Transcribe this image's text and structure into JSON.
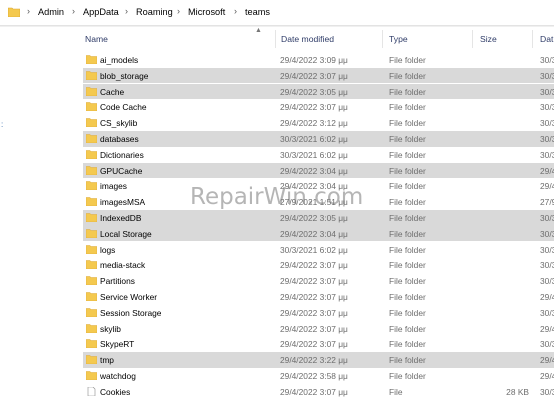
{
  "breadcrumb": [
    "Admin",
    "AppData",
    "Roaming",
    "Microsoft",
    "teams"
  ],
  "sidebar": {
    "glyph": ":"
  },
  "columns": {
    "name": "Name",
    "date": "Date modified",
    "type": "Type",
    "size": "Size",
    "date2": "Dat"
  },
  "rows": [
    {
      "name": "ai_models",
      "date": "29/4/2022 3:09 μμ",
      "type": "File folder",
      "size": "",
      "date2": "30/3",
      "selected": false,
      "kind": "folder"
    },
    {
      "name": "blob_storage",
      "date": "29/4/2022 3:07 μμ",
      "type": "File folder",
      "size": "",
      "date2": "30/3",
      "selected": true,
      "kind": "folder"
    },
    {
      "name": "Cache",
      "date": "29/4/2022 3:05 μμ",
      "type": "File folder",
      "size": "",
      "date2": "30/3",
      "selected": true,
      "kind": "folder"
    },
    {
      "name": "Code Cache",
      "date": "29/4/2022 3:07 μμ",
      "type": "File folder",
      "size": "",
      "date2": "30/3",
      "selected": false,
      "kind": "folder"
    },
    {
      "name": "CS_skylib",
      "date": "29/4/2022 3:12 μμ",
      "type": "File folder",
      "size": "",
      "date2": "30/3",
      "selected": false,
      "kind": "folder"
    },
    {
      "name": "databases",
      "date": "30/3/2021 6:02 μμ",
      "type": "File folder",
      "size": "",
      "date2": "30/3",
      "selected": true,
      "kind": "folder"
    },
    {
      "name": "Dictionaries",
      "date": "30/3/2021 6:02 μμ",
      "type": "File folder",
      "size": "",
      "date2": "30/3",
      "selected": false,
      "kind": "folder"
    },
    {
      "name": "GPUCache",
      "date": "29/4/2022 3:04 μμ",
      "type": "File folder",
      "size": "",
      "date2": "29/4",
      "selected": true,
      "kind": "folder"
    },
    {
      "name": "images",
      "date": "29/4/2022 3:04 μμ",
      "type": "File folder",
      "size": "",
      "date2": "29/4",
      "selected": false,
      "kind": "folder"
    },
    {
      "name": "imagesMSA",
      "date": "27/9/2021 1:51 μμ",
      "type": "File folder",
      "size": "",
      "date2": "27/9",
      "selected": false,
      "kind": "folder"
    },
    {
      "name": "IndexedDB",
      "date": "29/4/2022 3:05 μμ",
      "type": "File folder",
      "size": "",
      "date2": "30/3",
      "selected": true,
      "kind": "folder"
    },
    {
      "name": "Local Storage",
      "date": "29/4/2022 3:04 μμ",
      "type": "File folder",
      "size": "",
      "date2": "30/3",
      "selected": true,
      "kind": "folder"
    },
    {
      "name": "logs",
      "date": "30/3/2021 6:02 μμ",
      "type": "File folder",
      "size": "",
      "date2": "30/3",
      "selected": false,
      "kind": "folder"
    },
    {
      "name": "media-stack",
      "date": "29/4/2022 3:07 μμ",
      "type": "File folder",
      "size": "",
      "date2": "30/3",
      "selected": false,
      "kind": "folder"
    },
    {
      "name": "Partitions",
      "date": "29/4/2022 3:07 μμ",
      "type": "File folder",
      "size": "",
      "date2": "30/3",
      "selected": false,
      "kind": "folder"
    },
    {
      "name": "Service Worker",
      "date": "29/4/2022 3:07 μμ",
      "type": "File folder",
      "size": "",
      "date2": "29/4",
      "selected": false,
      "kind": "folder"
    },
    {
      "name": "Session Storage",
      "date": "29/4/2022 3:07 μμ",
      "type": "File folder",
      "size": "",
      "date2": "30/3",
      "selected": false,
      "kind": "folder"
    },
    {
      "name": "skylib",
      "date": "29/4/2022 3:07 μμ",
      "type": "File folder",
      "size": "",
      "date2": "29/4",
      "selected": false,
      "kind": "folder"
    },
    {
      "name": "SkypeRT",
      "date": "29/4/2022 3:07 μμ",
      "type": "File folder",
      "size": "",
      "date2": "30/3",
      "selected": false,
      "kind": "folder"
    },
    {
      "name": "tmp",
      "date": "29/4/2022 3:22 μμ",
      "type": "File folder",
      "size": "",
      "date2": "29/4",
      "selected": true,
      "kind": "folder"
    },
    {
      "name": "watchdog",
      "date": "29/4/2022 3:58 μμ",
      "type": "File folder",
      "size": "",
      "date2": "29/4",
      "selected": false,
      "kind": "folder"
    },
    {
      "name": "Cookies",
      "date": "29/4/2022 3:07 μμ",
      "type": "File",
      "size": "28 KB",
      "date2": "30/3",
      "selected": false,
      "kind": "file"
    }
  ],
  "watermark": "RepairWin.com",
  "colors": {
    "folder": "#f4c94f",
    "folder_dark": "#e0a82e",
    "selected_row": "#d9d9d9",
    "header_text": "#2f3c68"
  }
}
